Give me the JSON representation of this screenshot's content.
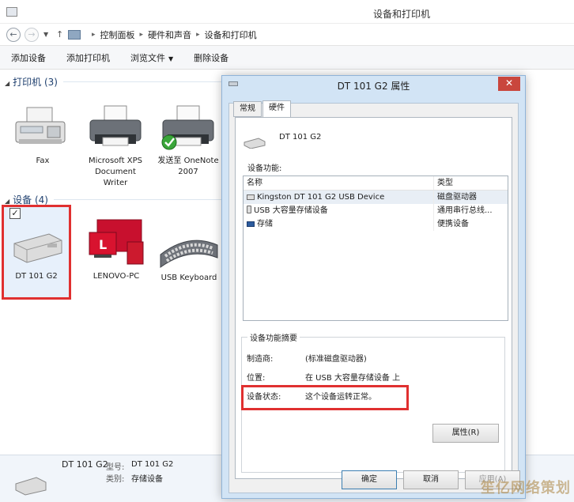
{
  "window": {
    "title": "设备和打印机"
  },
  "addressbar": {
    "back_icon": "arrow-left-icon",
    "forward_icon": "arrow-right-icon",
    "up_icon": "arrow-up-icon",
    "crumbs": [
      "控制面板",
      "硬件和声音",
      "设备和打印机"
    ]
  },
  "toolbar": {
    "add_device": "添加设备",
    "add_printer": "添加打印机",
    "browse_files": "浏览文件",
    "remove_device": "删除设备"
  },
  "printers": {
    "header": "打印机 (3)",
    "items": [
      {
        "name_line1": "Fax",
        "name_line2": "",
        "name_line3": ""
      },
      {
        "name_line1": "Microsoft XPS",
        "name_line2": "Document",
        "name_line3": "Writer"
      },
      {
        "name_line1": "发送至 OneNote",
        "name_line2": "2007",
        "name_line3": ""
      }
    ]
  },
  "devices": {
    "header": "设备 (4)",
    "items": [
      {
        "name": "DT 101 G2"
      },
      {
        "name": "LENOVO-PC"
      },
      {
        "name": "USB Keyboard"
      }
    ]
  },
  "details": {
    "device_name": "DT 101 G2",
    "model_label": "型号:",
    "model_value": "DT 101 G2",
    "category_label": "类别:",
    "category_value": "存储设备"
  },
  "dialog": {
    "title": "DT 101 G2 属性",
    "close_label": "✕",
    "tabs": [
      "常规",
      "硬件"
    ],
    "device_name": "DT 101 G2",
    "functions_label": "设备功能:",
    "columns": [
      "名称",
      "类型"
    ],
    "rows": [
      {
        "name": "Kingston DT 101 G2 USB Device",
        "type": "磁盘驱动器",
        "icon": "disk-drive-icon"
      },
      {
        "name": "USB 大容量存储设备",
        "type": "通用串行总线...",
        "icon": "usb-icon"
      },
      {
        "name": "存储",
        "type": "便携设备",
        "icon": "storage-icon"
      }
    ],
    "summary_label": "设备功能摘要",
    "manufacturer_label": "制造商:",
    "manufacturer_value": "(标准磁盘驱动器)",
    "location_label": "位置:",
    "location_value": "在 USB 大容量存储设备 上",
    "status_label": "设备状态:",
    "status_value": "这个设备运转正常。",
    "properties_button": "属性(R)",
    "ok_button": "确定",
    "cancel_button": "取消",
    "apply_button": "应用(A)"
  },
  "watermark": "笙亿网络策划",
  "colors": {
    "highlight_red": "#e03030",
    "dialog_frame": "#d2e4f5",
    "close_red": "#c9463d"
  }
}
